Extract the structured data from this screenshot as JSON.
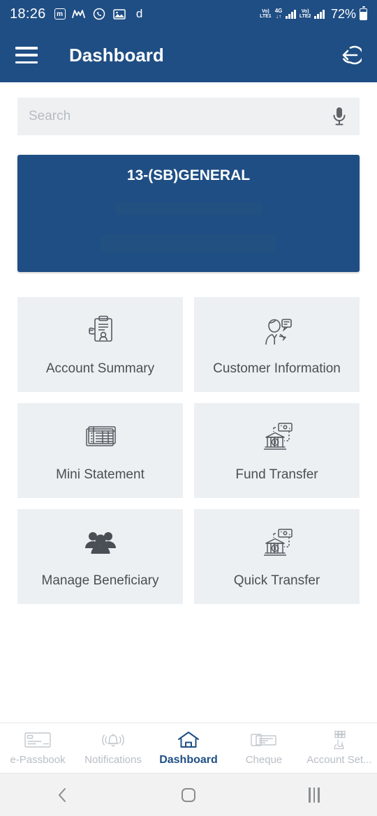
{
  "status_bar": {
    "clock": "18:26",
    "notification_icons": [
      {
        "name": "boxed-m-icon",
        "glyph": "m"
      },
      {
        "name": "wave-m-icon",
        "glyph": "Μ"
      },
      {
        "name": "whatsapp-icon",
        "glyph": "ⓦ"
      },
      {
        "name": "gallery-icon",
        "glyph": "⌗"
      },
      {
        "name": "d-app-icon",
        "glyph": "d"
      }
    ],
    "sim1_volte_top": "Vo)",
    "sim1_volte_bottom": "LTE1",
    "network_type": "4G",
    "network_arrows": "↓↑",
    "sim2_volte_top": "Vo)",
    "sim2_volte_bottom": "LTE2",
    "battery_percent": "72%"
  },
  "app_bar": {
    "menu_icon": "hamburger-icon",
    "title": "Dashboard",
    "logout_icon": "logout-icon"
  },
  "search": {
    "placeholder": "Search",
    "value": "",
    "mic_icon": "microphone-icon"
  },
  "account_card": {
    "name": "13-(SB)GENERAL",
    "account_number_masked": "",
    "balance_masked": ""
  },
  "tiles": [
    {
      "label": "Account Summary",
      "icon": "account-summary-icon"
    },
    {
      "label": "Customer Information",
      "icon": "customer-information-icon"
    },
    {
      "label": "Mini Statement",
      "icon": "mini-statement-icon"
    },
    {
      "label": "Fund Transfer",
      "icon": "fund-transfer-icon"
    },
    {
      "label": "Manage Beneficiary",
      "icon": "manage-beneficiary-icon"
    },
    {
      "label": "Quick Transfer",
      "icon": "quick-transfer-icon"
    }
  ],
  "bottom_nav": [
    {
      "label": "e-Passbook",
      "icon": "passbook-icon",
      "active": false
    },
    {
      "label": "Notifications",
      "icon": "bell-icon",
      "active": false
    },
    {
      "label": "Dashboard",
      "icon": "home-icon",
      "active": true
    },
    {
      "label": "Cheque",
      "icon": "cheque-icon",
      "active": false
    },
    {
      "label": "Account Set...",
      "icon": "account-settings-icon",
      "active": false
    }
  ],
  "system_nav": {
    "back": "back-icon",
    "home": "home-square-icon",
    "recents": "recents-icon"
  },
  "colors": {
    "brand_blue": "#1f4e84",
    "tile_bg": "#edf0f2",
    "search_bg": "#eef0f2",
    "nav_inactive": "#b9bec4"
  }
}
